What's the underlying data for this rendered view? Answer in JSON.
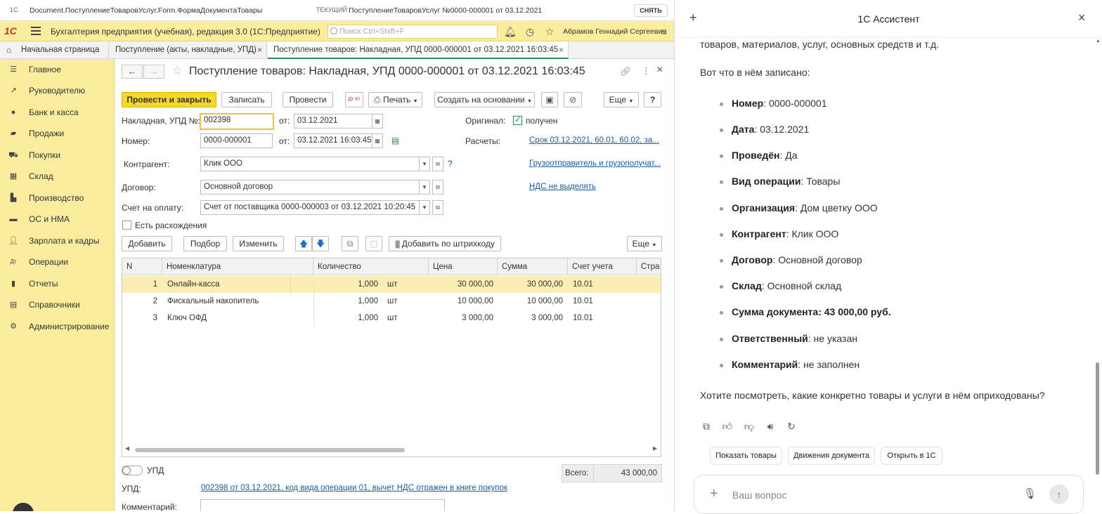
{
  "titlebar": {
    "brand": "1С",
    "path": "Document.ПоступлениеТоваровУслуг.Form.ФормаДокументаТовары",
    "current_label": "ТЕКУЩИЙ",
    "current_doc": "ПоступлениеТоваровУслуг №0000-000001 от 03.12.2021",
    "snyat": "СНЯТЬ"
  },
  "appbar": {
    "title": "Бухгалтерия предприятия (учебная), редакция 3.0  (1С:Предприятие)",
    "search_placeholder": "Поиск Ctrl+Shift+F",
    "user": "Абрамов Геннадий Сергеевич"
  },
  "tabs": [
    {
      "label": "Начальная страница"
    },
    {
      "label": "Поступление (акты, накладные, УПД)"
    },
    {
      "label": "Поступление товаров: Накладная, УПД 0000-000001 от 03.12.2021 16:03:45"
    }
  ],
  "sidebar": {
    "items": [
      {
        "label": "Главное"
      },
      {
        "label": "Руководителю"
      },
      {
        "label": "Банк и касса"
      },
      {
        "label": "Продажи"
      },
      {
        "label": "Покупки"
      },
      {
        "label": "Склад"
      },
      {
        "label": "Производство"
      },
      {
        "label": "ОС и НМА"
      },
      {
        "label": "Зарплата и кадры"
      },
      {
        "label": "Операции"
      },
      {
        "label": "Отчеты"
      },
      {
        "label": "Справочники"
      },
      {
        "label": "Администрирование"
      }
    ]
  },
  "document": {
    "title": "Поступление товаров: Накладная, УПД 0000-000001 от 03.12.2021 16:03:45",
    "toolbar": {
      "post_close": "Провести и закрыть",
      "save": "Записать",
      "post": "Провести",
      "dtkt": "Дт Кт",
      "print": "Печать",
      "create_based": "Создать на основании",
      "more": "Еще",
      "help": "?"
    },
    "fields": {
      "invoice_label": "Накладная, УПД №:",
      "invoice_no": "002398",
      "from_label": "от:",
      "invoice_date": "03.12.2021",
      "original_label": "Оригинал:",
      "original_value": "получен",
      "number_label": "Номер:",
      "number": "0000-000001",
      "number_date": "03.12.2021 16:03:45",
      "settlements_label": "Расчеты:",
      "settlements_link": "Срок 03.12.2021, 60.01, 60.02, за...",
      "counterparty_label": "Контрагент:",
      "counterparty": "Клик ООО",
      "help_q": "?",
      "shipper_link": "Грузоотправитель и грузополучат...",
      "contract_label": "Договор:",
      "contract": "Основной договор",
      "vat_link": "НДС не выделять",
      "bill_label": "Счет на оплату:",
      "bill": "Счет от поставщика 0000-000003 от 03.12.2021 10:20:45",
      "discrepancy_label": "Есть расхождения"
    },
    "table_toolbar": {
      "add": "Добавить",
      "pick": "Подбор",
      "change": "Изменить",
      "barcode": "Добавить по штрихкоду",
      "more": "Еще"
    },
    "table": {
      "headers": [
        "N",
        "Номенклатура",
        "Количество",
        "Цена",
        "Сумма",
        "Счет учета",
        "Стра"
      ],
      "rows": [
        {
          "n": "1",
          "name": "Онлайн-касса",
          "qty": "1,000",
          "unit": "шт",
          "price": "30 000,00",
          "sum": "30 000,00",
          "account": "10.01"
        },
        {
          "n": "2",
          "name": "Фискальный накопитель",
          "qty": "1,000",
          "unit": "шт",
          "price": "10 000,00",
          "sum": "10 000,00",
          "account": "10.01"
        },
        {
          "n": "3",
          "name": "Ключ ОФД",
          "qty": "1,000",
          "unit": "шт",
          "price": "3 000,00",
          "sum": "3 000,00",
          "account": "10.01"
        }
      ]
    },
    "footer": {
      "upd_toggle_label": "УПД",
      "total_label": "Всего:",
      "total": "43 000,00",
      "upd_label": "УПД:",
      "upd_link": "002398 от 03.12.2021, код вида операции 01, вычет НДС отражен в книге покупок",
      "comment_label": "Комментарий:"
    }
  },
  "assistant": {
    "title": "1С Ассистент",
    "intro_tail": "товаров, материалов, услуг, основных средств и т.д.",
    "lead": "Вот что в нём записано:",
    "items": [
      {
        "k": "Номер",
        "v": ": 0000-000001"
      },
      {
        "k": "Дата",
        "v": ": 03.12.2021"
      },
      {
        "k": "Проведён",
        "v": ": Да"
      },
      {
        "k": "Вид операции",
        "v": ": Товары"
      },
      {
        "k": "Организация",
        "v": ": Дом цветку ООО"
      },
      {
        "k": "Контрагент",
        "v": ": Клик ООО"
      },
      {
        "k": "Договор",
        "v": ": Основной договор"
      },
      {
        "k": "Склад",
        "v": ": Основной склад"
      },
      {
        "k": "Сумма документа: 43 000,00 руб.",
        "v": ""
      },
      {
        "k": "Ответственный",
        "v": ": не указан"
      },
      {
        "k": "Комментарий",
        "v": ": не заполнен"
      }
    ],
    "question": "Хотите посмотреть, какие конкретно товары и услуги в нём оприходованы?",
    "chips": [
      "Показать товары",
      "Движения документа",
      "Открыть в 1С"
    ],
    "input_placeholder": "Ваш вопрос"
  }
}
